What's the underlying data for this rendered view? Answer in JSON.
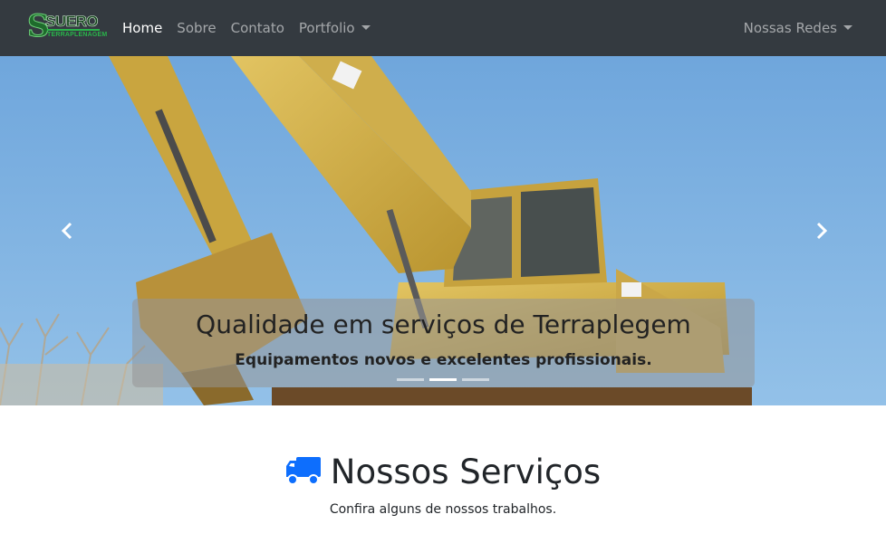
{
  "navbar": {
    "brand": {
      "name": "SUERO",
      "sub": "TERRAPLENAGEM",
      "mark": "S"
    },
    "links": [
      {
        "label": "Home",
        "active": true
      },
      {
        "label": "Sobre"
      },
      {
        "label": "Contato"
      },
      {
        "label": "Portfolio",
        "dropdown": true
      }
    ],
    "right": {
      "label": "Nossas Redes",
      "dropdown": true
    }
  },
  "carousel": {
    "caption_title": "Qualidade em serviços de Terraplegem",
    "caption_text": "Equipamentos novos e excelentes profissionais.",
    "indicators": 3,
    "active_slide": 2,
    "prev_icon": "chevron-left-icon",
    "next_icon": "chevron-right-icon"
  },
  "services": {
    "title": "Nossos Serviços",
    "subtitle": "Confira alguns de nossos trabalhos.",
    "icon": "truck-icon",
    "icon_color": "#0d6efd"
  },
  "colors": {
    "navbar_bg": "#343a40",
    "sky": "#7fb0de",
    "excavator_yellow": "#d9b94a"
  }
}
